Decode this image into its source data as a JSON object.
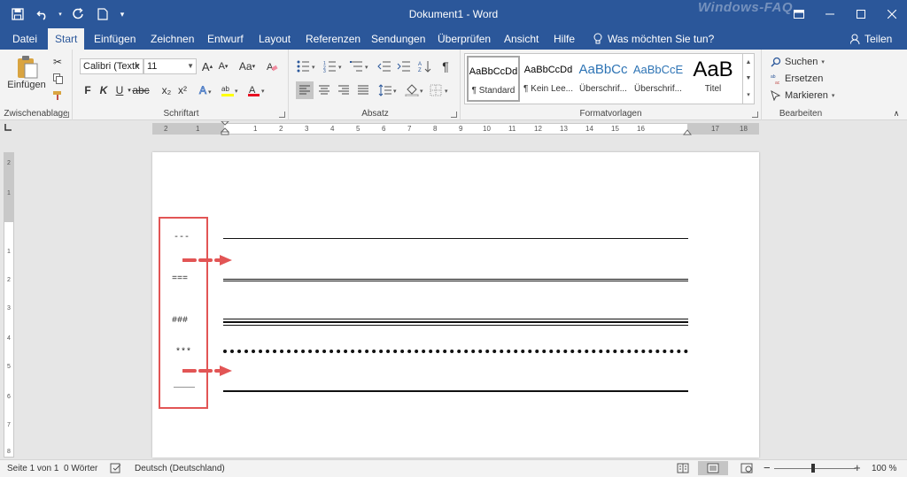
{
  "app": {
    "title": "Dokument1 - Word",
    "watermark": "Windows-FAQ"
  },
  "tabs": [
    "Datei",
    "Start",
    "Einfügen",
    "Zeichnen",
    "Entwurf",
    "Layout",
    "Referenzen",
    "Sendungen",
    "Überprüfen",
    "Ansicht",
    "Hilfe"
  ],
  "active_tab": "Start",
  "tell_me": "Was möchten Sie tun?",
  "share_label": "Teilen",
  "ribbon": {
    "clipboard": {
      "paste_label": "Einfügen",
      "group_label": "Zwischenablage"
    },
    "font": {
      "font_name": "Calibri (Textk",
      "font_size": "11",
      "bold": "F",
      "italic": "K",
      "underline": "U",
      "subscript": "x₂",
      "superscript": "x²",
      "grow": "A",
      "shrink": "A",
      "case": "Aa",
      "group_label": "Schriftart"
    },
    "paragraph": {
      "group_label": "Absatz"
    },
    "styles": {
      "items": [
        {
          "preview": "AaBbCcDd",
          "name": "¶ Standard"
        },
        {
          "preview": "AaBbCcDd",
          "name": "¶ Kein Lee..."
        },
        {
          "preview": "AaBbCc",
          "name": "Überschrif..."
        },
        {
          "preview": "AaBbCcE",
          "name": "Überschrif..."
        },
        {
          "preview": "AaB",
          "name": "Titel"
        }
      ],
      "group_label": "Formatvorlagen"
    },
    "editing": {
      "search": "Suchen",
      "replace": "Ersetzen",
      "select": "Markieren",
      "group_label": "Bearbeiten"
    }
  },
  "ruler": {
    "h_labels": [
      "2",
      "1",
      "1",
      "2",
      "3",
      "4",
      "5",
      "6",
      "7",
      "8",
      "9",
      "10",
      "11",
      "12",
      "13",
      "14",
      "15",
      "16",
      "17",
      "18"
    ],
    "v_labels": [
      "2",
      "1",
      "1",
      "1",
      "2",
      "3",
      "4",
      "5",
      "6",
      "7",
      "8"
    ]
  },
  "document": {
    "codes": [
      "---",
      "===",
      "###",
      "***",
      "____"
    ]
  },
  "status": {
    "page": "Seite 1 von 1",
    "words": "0 Wörter",
    "language": "Deutsch (Deutschland)",
    "zoom": "100 %",
    "zoom_minus": "−",
    "zoom_plus": "+"
  },
  "colors": {
    "title_bar": "#2b579a",
    "highlight": "#e25555"
  }
}
